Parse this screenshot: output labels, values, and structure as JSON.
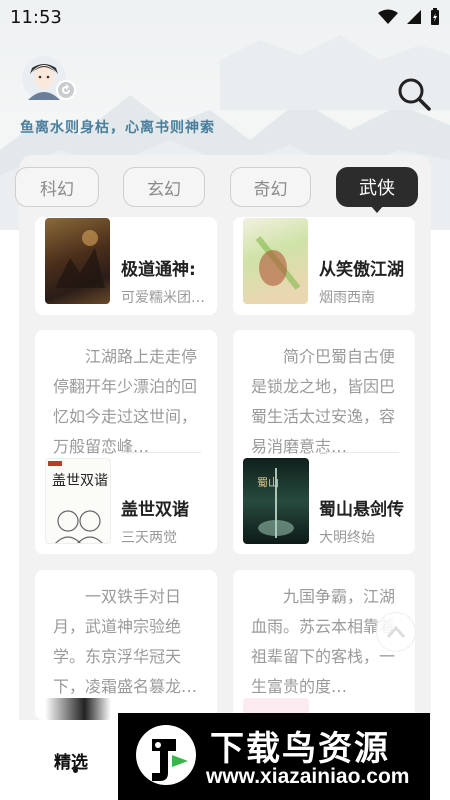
{
  "status": {
    "time": "11:53"
  },
  "header": {
    "slogan": "鱼离水则身枯，心离书则神索"
  },
  "tabs": [
    {
      "label": "科幻"
    },
    {
      "label": "玄幻"
    },
    {
      "label": "奇幻"
    },
    {
      "label": "武侠",
      "active": true
    }
  ],
  "books": [
    {
      "title": "极道通神:",
      "author": "可爱糯米团…"
    },
    {
      "title": "从笑傲江湖",
      "author": "烟雨西南"
    },
    {
      "summary": "江湖路上走走停停翻开年少漂泊的回忆如今走过这世间，万般留恋峰…",
      "title": "盖世双谐",
      "author": "三天两觉"
    },
    {
      "summary": "简介巴蜀自古便是锁龙之地，皆因巴蜀生活太过安逸，容易消磨意志…",
      "title": "蜀山悬剑传",
      "author": "大明终始"
    },
    {
      "summary": "一双铁手对日月，武道神宗验绝学。东京浮华冠天下，凌霜盛名篡龙…"
    },
    {
      "summary": "九国争霸，江湖血雨。苏云本相靠着祖辈留下的客栈，一生富贵的度…"
    }
  ],
  "nav": {
    "selected_label": "精选"
  },
  "watermark": {
    "title": "下载鸟资源",
    "url": "www.xiazainiao.com"
  }
}
